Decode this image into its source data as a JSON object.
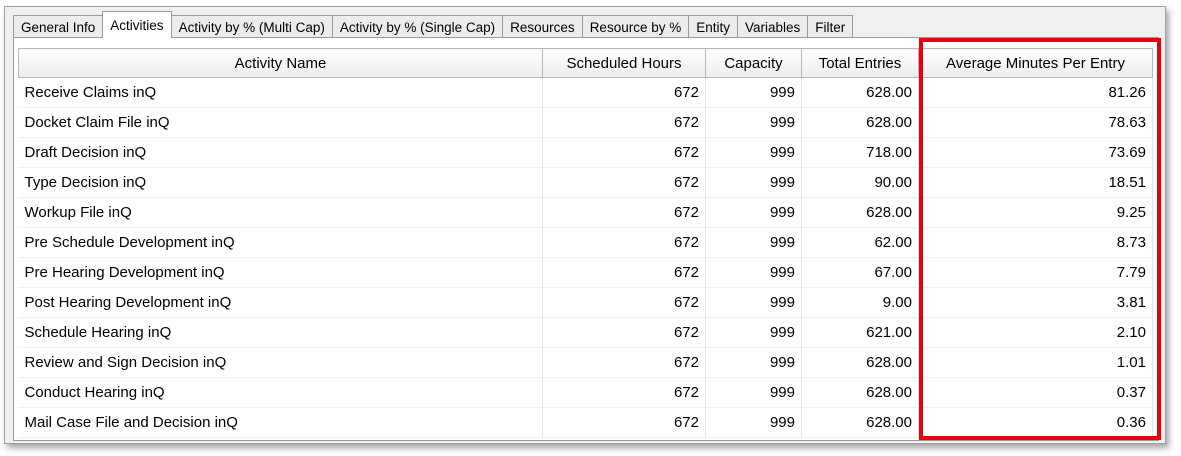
{
  "tabs": [
    {
      "label": "General Info",
      "active": false
    },
    {
      "label": "Activities",
      "active": true
    },
    {
      "label": "Activity by % (Multi Cap)",
      "active": false
    },
    {
      "label": "Activity by % (Single Cap)",
      "active": false
    },
    {
      "label": "Resources",
      "active": false
    },
    {
      "label": "Resource by %",
      "active": false
    },
    {
      "label": "Entity",
      "active": false
    },
    {
      "label": "Variables",
      "active": false
    },
    {
      "label": "Filter",
      "active": false
    }
  ],
  "table": {
    "columns": [
      "Activity Name",
      "Scheduled Hours",
      "Capacity",
      "Total Entries",
      "Average Minutes Per Entry"
    ],
    "rows": [
      [
        "Receive Claims inQ",
        "672",
        "999",
        "628.00",
        "81.26"
      ],
      [
        "Docket Claim File inQ",
        "672",
        "999",
        "628.00",
        "78.63"
      ],
      [
        "Draft Decision inQ",
        "672",
        "999",
        "718.00",
        "73.69"
      ],
      [
        "Type Decision inQ",
        "672",
        "999",
        "90.00",
        "18.51"
      ],
      [
        "Workup File inQ",
        "672",
        "999",
        "628.00",
        "9.25"
      ],
      [
        "Pre Schedule Development inQ",
        "672",
        "999",
        "62.00",
        "8.73"
      ],
      [
        "Pre Hearing Development inQ",
        "672",
        "999",
        "67.00",
        "7.79"
      ],
      [
        "Post Hearing Development inQ",
        "672",
        "999",
        "9.00",
        "3.81"
      ],
      [
        "Schedule Hearing inQ",
        "672",
        "999",
        "621.00",
        "2.10"
      ],
      [
        "Review and Sign Decision inQ",
        "672",
        "999",
        "628.00",
        "1.01"
      ],
      [
        "Conduct Hearing inQ",
        "672",
        "999",
        "628.00",
        "0.37"
      ],
      [
        "Mail Case File and Decision inQ",
        "672",
        "999",
        "628.00",
        "0.36"
      ]
    ]
  },
  "colors": {
    "highlight_border": "#e8000d"
  }
}
